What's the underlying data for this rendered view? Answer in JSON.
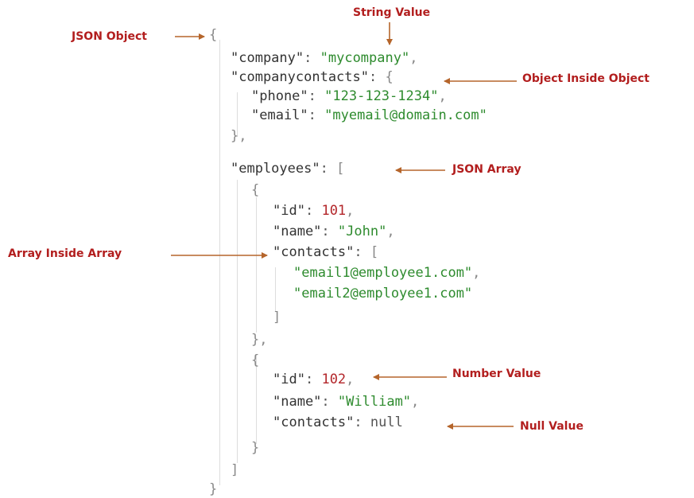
{
  "code_lines": [
    "{",
    "\"company\": \"mycompany\",",
    "\"companycontacts\": {",
    "\"phone\": \"123-123-1234\",",
    "\"email\": \"myemail@domain.com\"",
    "},",
    "\"employees\": [",
    "{",
    "\"id\": 101,",
    "\"name\": \"John\",",
    "\"contacts\": [",
    "\"email1@employee1.com\",",
    "\"email2@employee1.com\"",
    "]",
    "},",
    "{",
    "\"id\": 102,",
    "\"name\": \"William\",",
    "\"contacts\": null",
    "}",
    "]",
    "}"
  ],
  "annotations": {
    "json_object": "JSON Object",
    "string_value": "String Value",
    "object_inside_object": "Object Inside Object",
    "json_array": "JSON Array",
    "array_inside_array": "Array Inside Array",
    "number_value": "Number Value",
    "null_value": "Null Value"
  },
  "colors": {
    "label": "#b21e1e",
    "arrow": "#b5652b",
    "string": "#2e8b2e",
    "number": "#b3262a",
    "key": "#333333",
    "guide": "#dddddd"
  }
}
